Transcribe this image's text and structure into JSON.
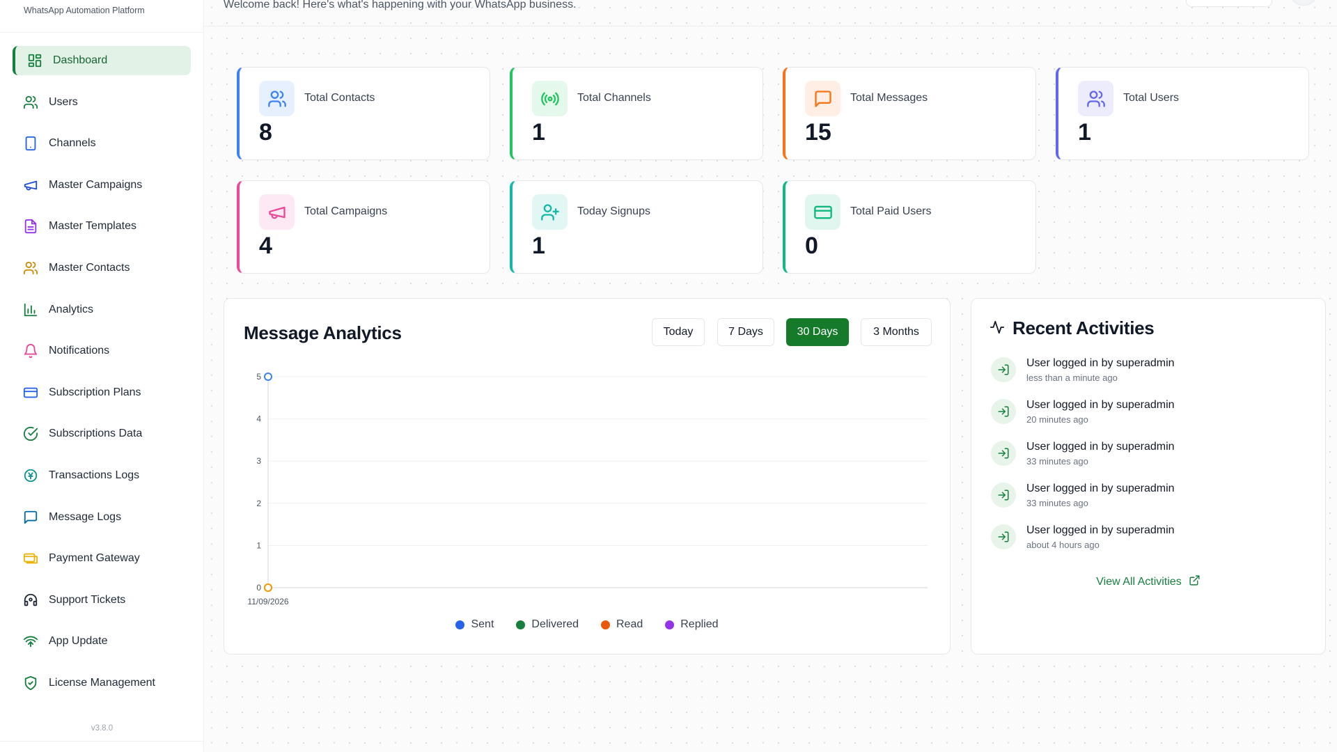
{
  "app": {
    "subtitle": "WhatsApp Automation Platform",
    "version": "v3.8.0"
  },
  "colors": {
    "brand_green": "#15803d",
    "blue": "#2563eb",
    "orange": "#ea580c",
    "purple": "#7c3aed",
    "pink": "#db2777",
    "teal": "#14b8a6",
    "amber": "#f59e0b"
  },
  "sidebar": {
    "items": [
      {
        "label": "Dashboard",
        "icon": "dashboard-grid-icon",
        "active": true
      },
      {
        "label": "Users",
        "icon": "users-icon"
      },
      {
        "label": "Channels",
        "icon": "smartphone-icon"
      },
      {
        "label": "Master Campaigns",
        "icon": "megaphone-icon"
      },
      {
        "label": "Master Templates",
        "icon": "file-text-icon"
      },
      {
        "label": "Master Contacts",
        "icon": "contacts-icon"
      },
      {
        "label": "Analytics",
        "icon": "bar-chart-icon"
      },
      {
        "label": "Notifications",
        "icon": "bell-icon"
      },
      {
        "label": "Subscription Plans",
        "icon": "credit-card-icon"
      },
      {
        "label": "Subscriptions Data",
        "icon": "check-circle-icon"
      },
      {
        "label": "Transactions Logs",
        "icon": "currency-circle-icon"
      },
      {
        "label": "Message Logs",
        "icon": "message-square-icon"
      },
      {
        "label": "Payment Gateway",
        "icon": "payment-gateway-icon"
      },
      {
        "label": "Support Tickets",
        "icon": "headset-icon"
      },
      {
        "label": "App Update",
        "icon": "app-update-icon"
      },
      {
        "label": "License Management",
        "icon": "shield-check-icon"
      }
    ]
  },
  "header": {
    "welcome": "Welcome back! Here's what's happening with your WhatsApp business."
  },
  "stats": [
    {
      "label": "Total Contacts",
      "value": "8",
      "icon": "users-icon",
      "color": "#3b82f6"
    },
    {
      "label": "Total Channels",
      "value": "1",
      "icon": "radio-broadcast-icon",
      "color": "#22c55e"
    },
    {
      "label": "Total Messages",
      "value": "15",
      "icon": "message-square-icon",
      "color": "#f97316"
    },
    {
      "label": "Total Users",
      "value": "1",
      "icon": "users-icon",
      "color": "#6366f1"
    },
    {
      "label": "Total Campaigns",
      "value": "4",
      "icon": "megaphone-icon",
      "color": "#ec4899"
    },
    {
      "label": "Today Signups",
      "value": "1",
      "icon": "user-plus-icon",
      "color": "#14b8a6"
    },
    {
      "label": "Total Paid Users",
      "value": "0",
      "icon": "credit-card-icon",
      "color": "#10b981"
    }
  ],
  "analytics": {
    "title": "Message Analytics",
    "ranges": [
      "Today",
      "7 Days",
      "30 Days",
      "3 Months"
    ],
    "active_range": "30 Days",
    "legend": [
      {
        "name": "Sent",
        "color": "#2563eb"
      },
      {
        "name": "Delivered",
        "color": "#15803d"
      },
      {
        "name": "Read",
        "color": "#ea580c"
      },
      {
        "name": "Replied",
        "color": "#9333ea"
      }
    ]
  },
  "chart_data": {
    "type": "line",
    "x": [
      "11/09/2026"
    ],
    "series": [
      {
        "name": "Sent",
        "values": [
          5
        ],
        "color": "#3b82f6"
      },
      {
        "name": "Delivered",
        "values": [
          0
        ],
        "color": "#15803d"
      },
      {
        "name": "Read",
        "values": [
          0
        ],
        "color": "#ea580c"
      },
      {
        "name": "Replied",
        "values": [
          0
        ],
        "color": "#f59e0b"
      }
    ],
    "ylim": [
      0,
      5
    ],
    "yticks": [
      0,
      1,
      2,
      3,
      4,
      5
    ],
    "grid": true,
    "legend": "bottom"
  },
  "activities": {
    "title": "Recent Activities",
    "items": [
      {
        "title": "User logged in by superadmin",
        "time": "less than a minute ago"
      },
      {
        "title": "User logged in by superadmin",
        "time": "20 minutes ago"
      },
      {
        "title": "User logged in by superadmin",
        "time": "33 minutes ago"
      },
      {
        "title": "User logged in by superadmin",
        "time": "33 minutes ago"
      },
      {
        "title": "User logged in by superadmin",
        "time": "about 4 hours ago"
      }
    ],
    "view_all": "View All Activities"
  }
}
